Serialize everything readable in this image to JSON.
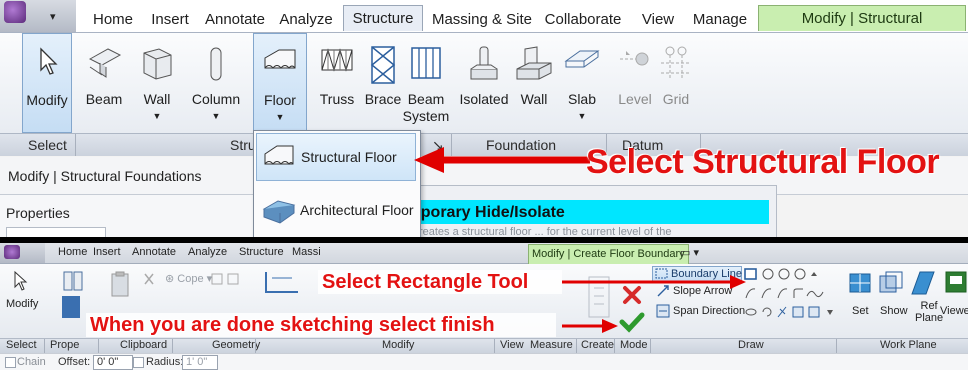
{
  "top": {
    "app_menu_arrow": "▾",
    "tabs": [
      "Home",
      "Insert",
      "Annotate",
      "Analyze",
      "Structure",
      "Massing & Site",
      "Collaborate",
      "View",
      "Manage",
      "Modify | Structural Foundations"
    ],
    "ribbon_buttons": {
      "modify": "Modify",
      "beam": "Beam",
      "wall": "Wall",
      "column": "Column",
      "floor": "Floor",
      "truss": "Truss",
      "brace": "Brace",
      "beam_system_1": "Beam",
      "beam_system_2": "System",
      "isolated": "Isolated",
      "found_wall": "Wall",
      "slab": "Slab",
      "level": "Level",
      "grid": "Grid"
    },
    "panels": {
      "select": "Select",
      "structure": "Stru",
      "foundation": "Foundation",
      "datum": "Datum",
      "launcher": "↘"
    },
    "context_label": "Modify | Structural Foundations",
    "properties_header": "Properties",
    "flyout": {
      "structural_floor": "Structural Floor",
      "architectural_floor": "Architectural Floor"
    },
    "tooltip": {
      "title": "nporary Hide/Isolate",
      "body": "Creates a structural floor ... for the current level of the"
    },
    "callout": "Select Structural Floor",
    "accent_color": "#e31212"
  },
  "bottom": {
    "tabs": [
      "Home",
      "Insert",
      "Annotate",
      "Analyze",
      "Structure",
      "Massi",
      "Modify | Create Floor Boundary"
    ],
    "tab_extra": "▭ ▾",
    "ribbon": {
      "modify": "Modify",
      "cope": "Cope",
      "boundary_line": "Boundary Line",
      "slope_arrow": "Slope Arrow",
      "span_direction": "Span Direction",
      "set": "Set",
      "show": "Show",
      "ref_plane_1": "Ref",
      "ref_plane_2": "Plane",
      "viewer": "Viewer"
    },
    "panels": {
      "select": "Select",
      "properties": "Prope",
      "clipboard": "Clipboard",
      "geometry": "Geometry",
      "modify": "Modify",
      "view": "View",
      "measure": "Measure",
      "create": "Create",
      "mode": "Mode",
      "draw": "Draw",
      "work_plane": "Work Plane"
    },
    "options": {
      "chain": "Chain",
      "offset_label": "Offset:",
      "offset_value": "0' 0\"",
      "radius_label": "Radius:",
      "radius_value": "1' 0\""
    },
    "callout_rectangle": "Select Rectangle Tool",
    "callout_finish": "When you are done sketching select finish"
  }
}
